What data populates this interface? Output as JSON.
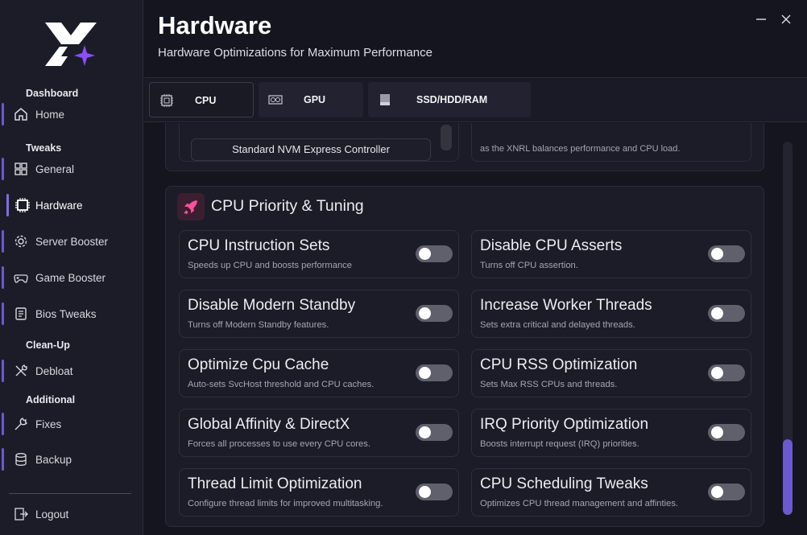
{
  "sidebar": {
    "sections": {
      "dashboard": "Dashboard",
      "tweaks": "Tweaks",
      "cleanup": "Clean-Up",
      "additional": "Additional"
    },
    "items": [
      {
        "label": "Home",
        "icon": "home-icon"
      },
      {
        "label": "General",
        "icon": "grid-icon"
      },
      {
        "label": "Hardware",
        "icon": "chip-icon"
      },
      {
        "label": "Server Booster",
        "icon": "gear-icon"
      },
      {
        "label": "Game Booster",
        "icon": "gamepad-icon"
      },
      {
        "label": "Bios Tweaks",
        "icon": "bios-icon"
      },
      {
        "label": "Debloat",
        "icon": "tools-icon"
      },
      {
        "label": "Fixes",
        "icon": "wrench-icon"
      },
      {
        "label": "Backup",
        "icon": "database-icon"
      }
    ],
    "logout": "Logout",
    "active": "Hardware"
  },
  "header": {
    "title": "Hardware",
    "subtitle": "Hardware Optimizations for Maximum Performance"
  },
  "tabs": [
    {
      "label": "CPU",
      "icon": "cpu-icon",
      "active": true
    },
    {
      "label": "GPU",
      "icon": "gpu-icon",
      "active": false
    },
    {
      "label": "SSD/HDD/RAM",
      "icon": "drive-icon",
      "active": false
    }
  ],
  "top_card": {
    "nvm_label": "Standard NVM Express Controller",
    "right_desc_partial": "as the XNRL balances performance and CPU load."
  },
  "section": {
    "title": "CPU Priority & Tuning",
    "icon": "rocket-icon",
    "tweaks": [
      {
        "title": "CPU Instruction Sets",
        "desc": "Speeds up CPU and boosts performance",
        "enabled": false
      },
      {
        "title": "Disable CPU Asserts",
        "desc": "Turns off CPU assertion.",
        "enabled": false
      },
      {
        "title": "Disable Modern Standby",
        "desc": "Turns off Modern Standby features.",
        "enabled": false
      },
      {
        "title": "Increase Worker Threads",
        "desc": "Sets extra critical and delayed threads.",
        "enabled": false
      },
      {
        "title": "Optimize Cpu Cache",
        "desc": "Auto-sets SvcHost threshold and CPU caches.",
        "enabled": false
      },
      {
        "title": "CPU RSS Optimization",
        "desc": "Sets Max RSS CPUs and threads.",
        "enabled": false
      },
      {
        "title": "Global Affinity & DirectX",
        "desc": "Forces all processes to use every CPU cores.",
        "enabled": false
      },
      {
        "title": "IRQ Priority Optimization",
        "desc": "Boosts interrupt request (IRQ) priorities.",
        "enabled": false
      },
      {
        "title": "Thread Limit Optimization",
        "desc": "Configure thread limits for improved multitasking.",
        "enabled": false
      },
      {
        "title": "CPU Scheduling Tweaks",
        "desc": "Optimizes CPU thread management and affinties.",
        "enabled": false
      }
    ]
  },
  "colors": {
    "accent": "#6a5acd",
    "background": "#151520",
    "sidebar": "#1c1c28",
    "card": "#1c1c28",
    "toggle_off": "#60606c",
    "rocket": "#ff4f9a"
  }
}
